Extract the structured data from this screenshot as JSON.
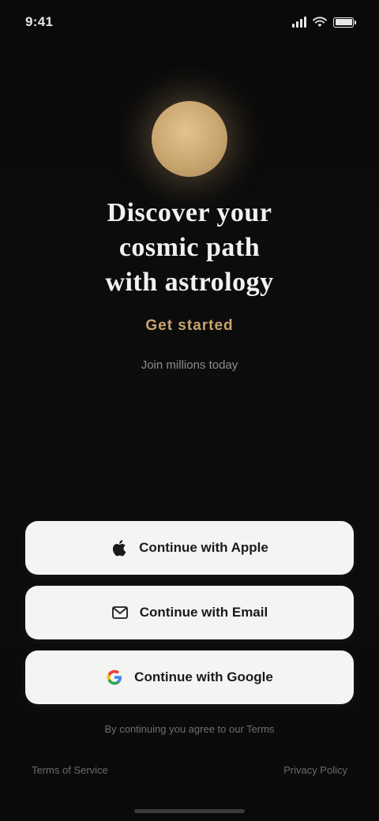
{
  "status_bar": {
    "time": "9:41",
    "battery_level": 1.0
  },
  "hero": {
    "headline_lines": [
      "Discover your",
      "cosmic path",
      "with astrology"
    ],
    "tagline": "Get started",
    "subtext": "Join millions today"
  },
  "auth": {
    "apple_label": "Continue with Apple",
    "apple_icon": "apple-icon",
    "email_label": "Continue with Email",
    "email_icon": "mail-icon",
    "google_label": "Continue with Google",
    "google_icon": "google-icon"
  },
  "terms_text": "By continuing you agree to our Terms",
  "footer": {
    "left_link": "Terms of Service",
    "right_link": "Privacy Policy"
  },
  "colors": {
    "background": "#0b0b0b",
    "accent": "#c8a46c",
    "button_bg": "#f4f4f2"
  }
}
